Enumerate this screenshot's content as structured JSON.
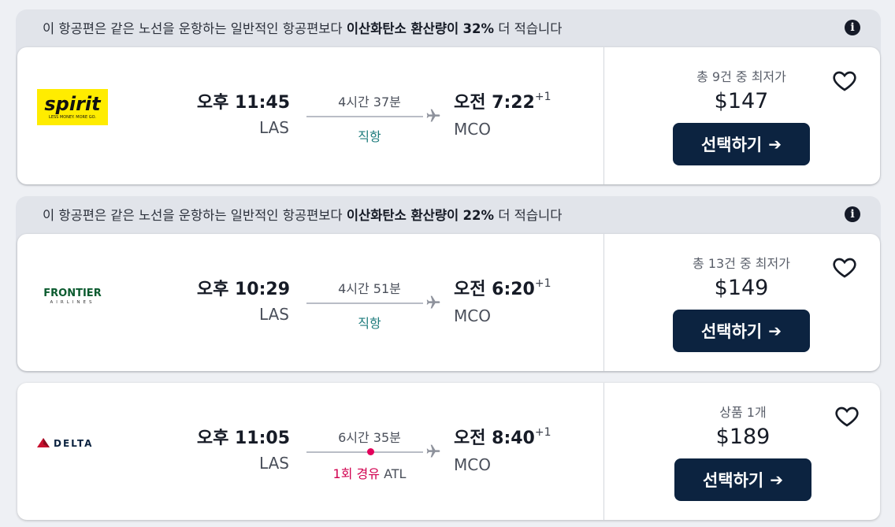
{
  "offers": [
    {
      "eco_prefix": "이 항공편은 같은 노선을 운항하는 일반적인 항공편보다",
      "eco_bold": "이산화탄소 환산량이",
      "eco_percent": "32%",
      "eco_suffix": "더 적습니다",
      "airline": "spirit",
      "airline_logo_text": "spirit",
      "airline_logo_tagline": "LESS MONEY. MORE GO.",
      "dep_time": "오후 11:45",
      "dep_airport": "LAS",
      "duration": "4시간 37분",
      "stops": "직항",
      "arr_time": "오전 7:22",
      "arr_offset": "+1",
      "arr_airport": "MCO",
      "deal_label": "총 9건 중 최저가",
      "price": "$147",
      "select_label": "선택하기"
    },
    {
      "eco_prefix": "이 항공편은 같은 노선을 운항하는 일반적인 항공편보다",
      "eco_bold": "이산화탄소 환산량이",
      "eco_percent": "22%",
      "eco_suffix": "더 적습니다",
      "airline": "frontier",
      "airline_logo_text": "FRONTIER",
      "airline_logo_tagline": "AIRLINES",
      "dep_time": "오후 10:29",
      "dep_airport": "LAS",
      "duration": "4시간 51분",
      "stops": "직항",
      "arr_time": "오전 6:20",
      "arr_offset": "+1",
      "arr_airport": "MCO",
      "deal_label": "총 13건 중 최저가",
      "price": "$149",
      "select_label": "선택하기"
    },
    {
      "airline": "delta",
      "airline_logo_text": "DELTA",
      "dep_time": "오후 11:05",
      "dep_airport": "LAS",
      "duration": "6시간 35분",
      "stops": "1회 경유",
      "stop_airport": "ATL",
      "arr_time": "오전 8:40",
      "arr_offset": "+1",
      "arr_airport": "MCO",
      "deal_label": "상품 1개",
      "price": "$189",
      "select_label": "선택하기"
    }
  ],
  "icons": {
    "info": "info-icon",
    "plane": "airplane-icon",
    "heart": "heart-outline-icon",
    "arrow": "arrow-right-icon"
  },
  "colors": {
    "button_bg": "#0c2340",
    "direct_text": "#1d7b7c",
    "stop_text": "#d1004f",
    "spirit_yellow": "#ffec00",
    "frontier_green": "#0b5b2f",
    "delta_red": "#c8102e",
    "delta_navy": "#0c2340"
  }
}
